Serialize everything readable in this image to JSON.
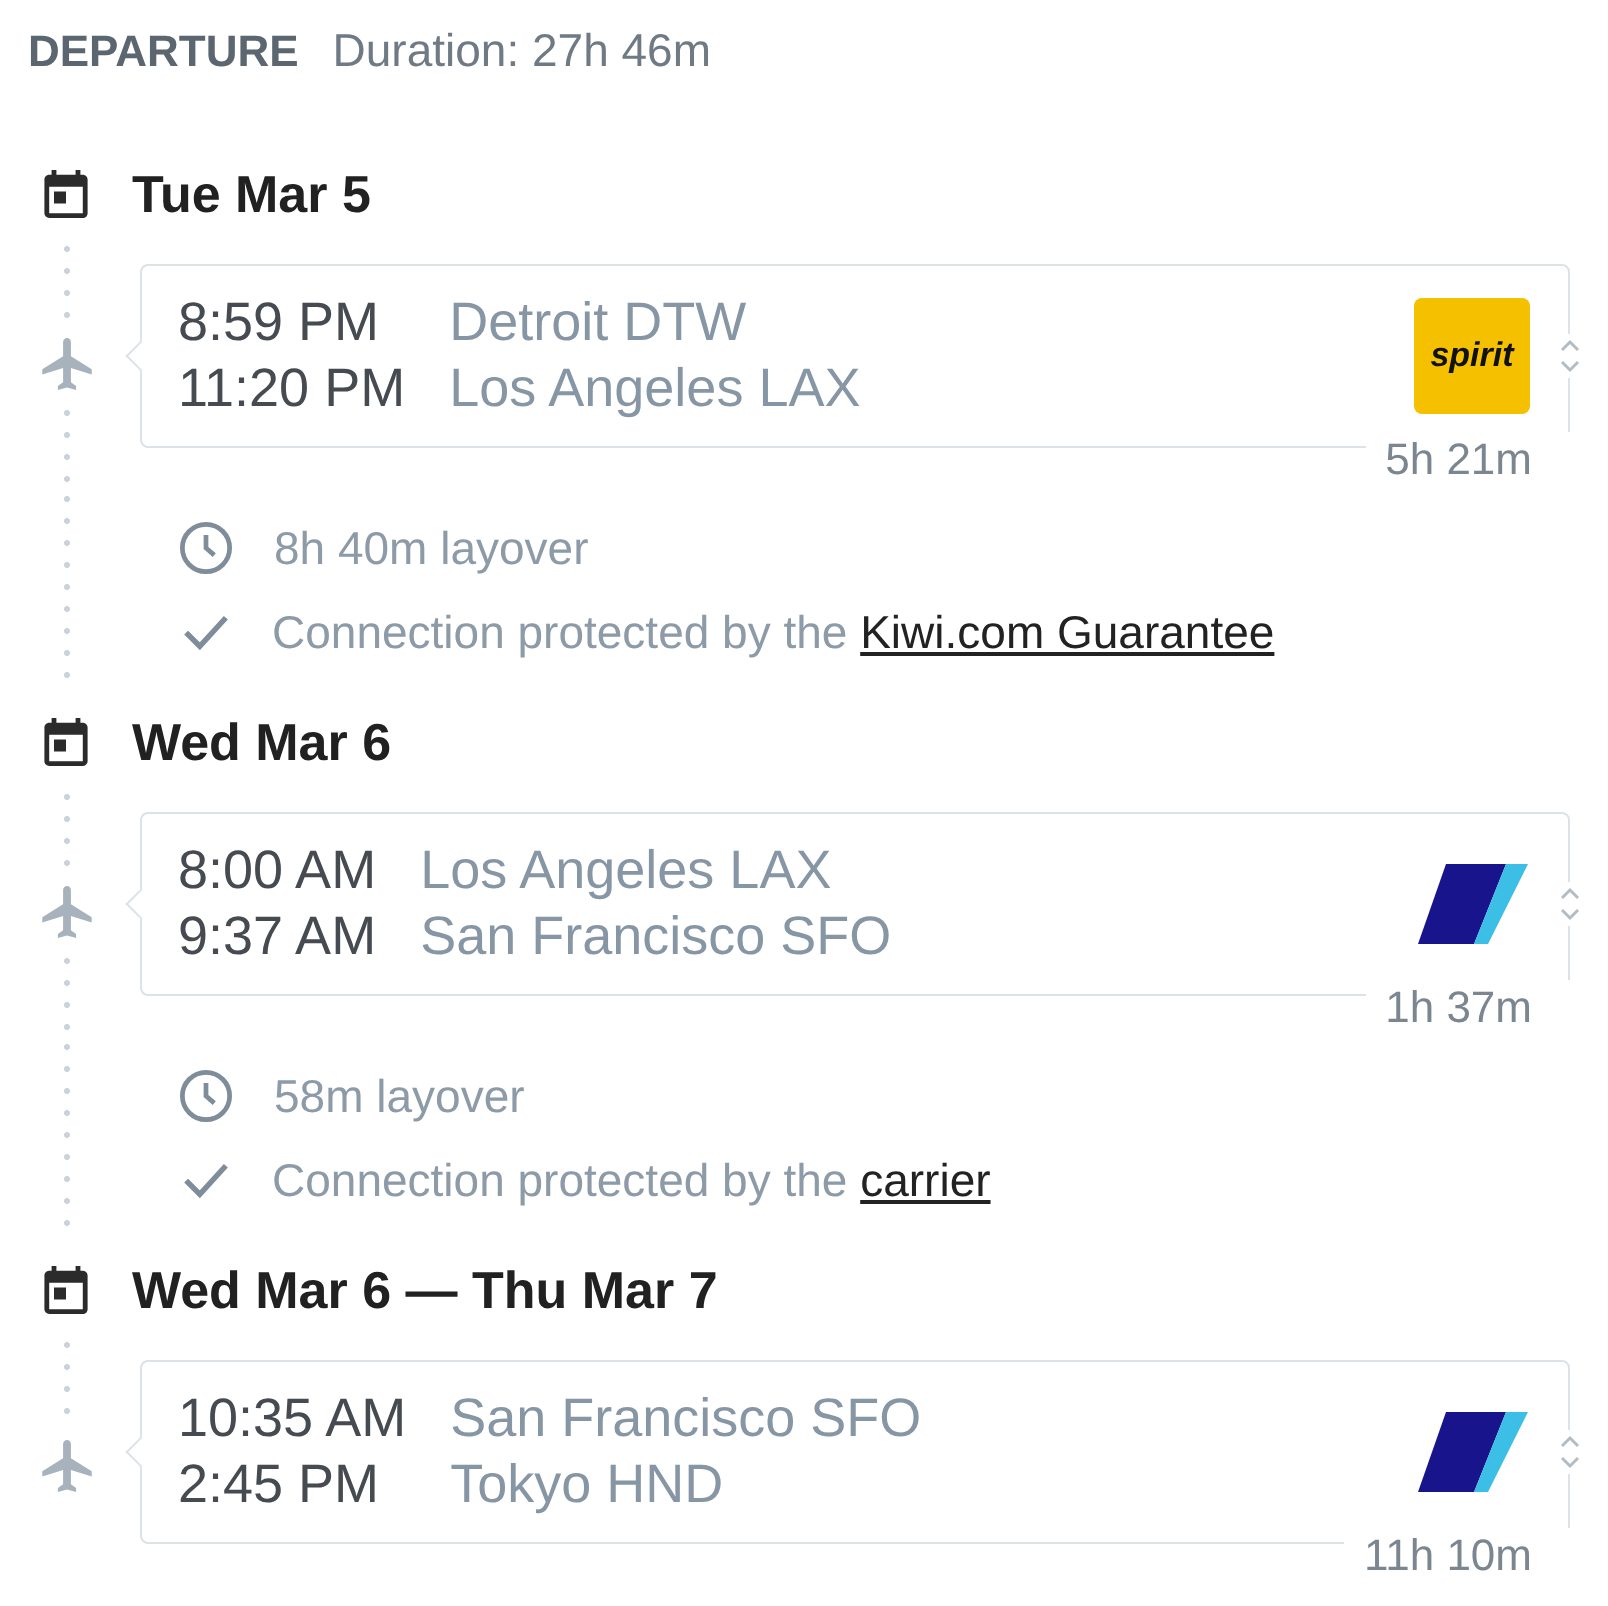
{
  "header": {
    "title": "DEPARTURE",
    "duration": "Duration: 27h 46m"
  },
  "legs": [
    {
      "date": "Tue Mar 5",
      "departure_time": "8:59 PM",
      "departure_place": "Detroit DTW",
      "arrival_time": "11:20 PM",
      "arrival_place": "Los Angeles LAX",
      "carrier_logo": {
        "kind": "text_tile",
        "text": "spirit"
      },
      "flight_duration": "5h 21m",
      "layover": {
        "text": "8h 40m layover",
        "protection": "Connection protected by the",
        "protection_link": "Kiwi.com Guarantee"
      }
    },
    {
      "date": "Wed Mar 6",
      "departure_time": "8:00 AM",
      "departure_place": "Los Angeles LAX",
      "arrival_time": "9:37 AM",
      "arrival_place": "San Francisco SFO",
      "carrier_logo": {
        "kind": "stripes"
      },
      "flight_duration": "1h 37m",
      "layover": {
        "text": "58m layover",
        "protection": "Connection protected by the",
        "protection_link": "carrier"
      }
    },
    {
      "date": "Wed Mar 6 — Thu Mar 7",
      "departure_time": "10:35 AM",
      "departure_place": "San Francisco SFO",
      "arrival_time": "2:45 PM",
      "arrival_place": "Tokyo HND",
      "carrier_logo": {
        "kind": "stripes"
      },
      "flight_duration": "11h 10m"
    }
  ]
}
